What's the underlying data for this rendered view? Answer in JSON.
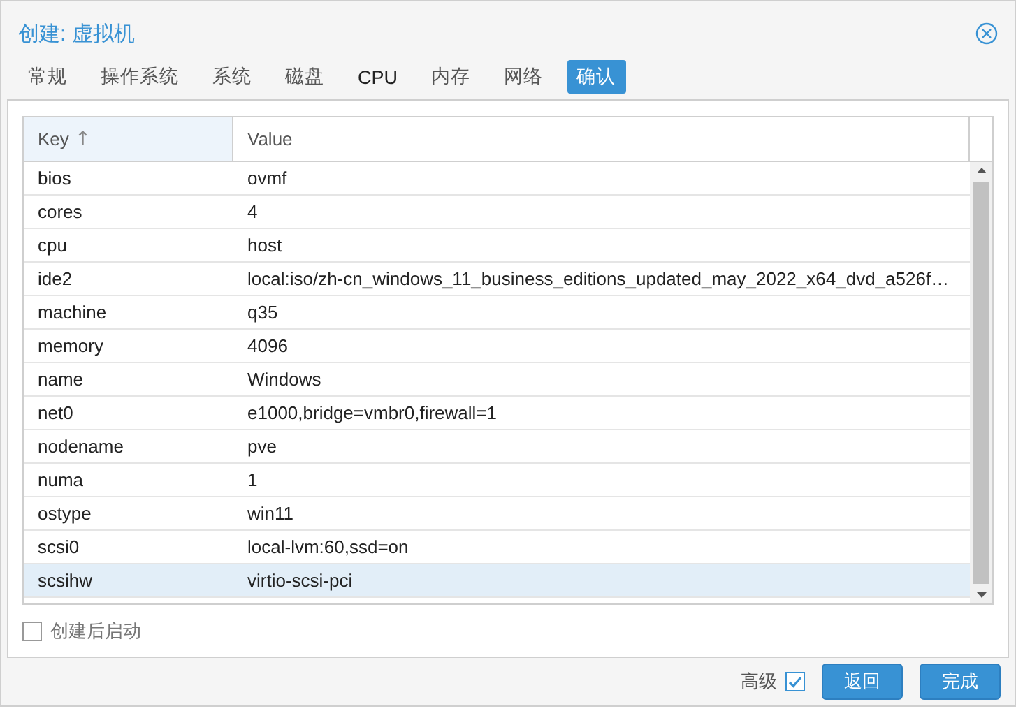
{
  "window": {
    "title": "创建: 虚拟机"
  },
  "tabs": [
    {
      "label": "常规",
      "selected": false
    },
    {
      "label": "操作系统",
      "selected": false
    },
    {
      "label": "系统",
      "selected": false
    },
    {
      "label": "磁盘",
      "selected": false
    },
    {
      "label": "CPU",
      "selected": false
    },
    {
      "label": "内存",
      "selected": false
    },
    {
      "label": "网络",
      "selected": false
    },
    {
      "label": "确认",
      "selected": true
    }
  ],
  "table": {
    "columns": [
      {
        "label": "Key",
        "sort_icon": "↑"
      },
      {
        "label": "Value"
      }
    ],
    "rows": [
      {
        "key": "bios",
        "value": "ovmf",
        "selected": false
      },
      {
        "key": "cores",
        "value": "4",
        "selected": false
      },
      {
        "key": "cpu",
        "value": "host",
        "selected": false
      },
      {
        "key": "ide2",
        "value": "local:iso/zh-cn_windows_11_business_editions_updated_may_2022_x64_dvd_a526f…",
        "selected": false
      },
      {
        "key": "machine",
        "value": "q35",
        "selected": false
      },
      {
        "key": "memory",
        "value": "4096",
        "selected": false
      },
      {
        "key": "name",
        "value": "Windows",
        "selected": false
      },
      {
        "key": "net0",
        "value": "e1000,bridge=vmbr0,firewall=1",
        "selected": false
      },
      {
        "key": "nodename",
        "value": "pve",
        "selected": false
      },
      {
        "key": "numa",
        "value": "1",
        "selected": false
      },
      {
        "key": "ostype",
        "value": "win11",
        "selected": false
      },
      {
        "key": "scsi0",
        "value": "local-lvm:60,ssd=on",
        "selected": false
      },
      {
        "key": "scsihw",
        "value": "virtio-scsi-pci",
        "selected": true
      }
    ]
  },
  "start_after_create": {
    "label": "创建后启动",
    "checked": false
  },
  "footer": {
    "advanced": {
      "label": "高级",
      "checked": true
    },
    "buttons": [
      {
        "label": "返回"
      },
      {
        "label": "完成"
      }
    ]
  }
}
